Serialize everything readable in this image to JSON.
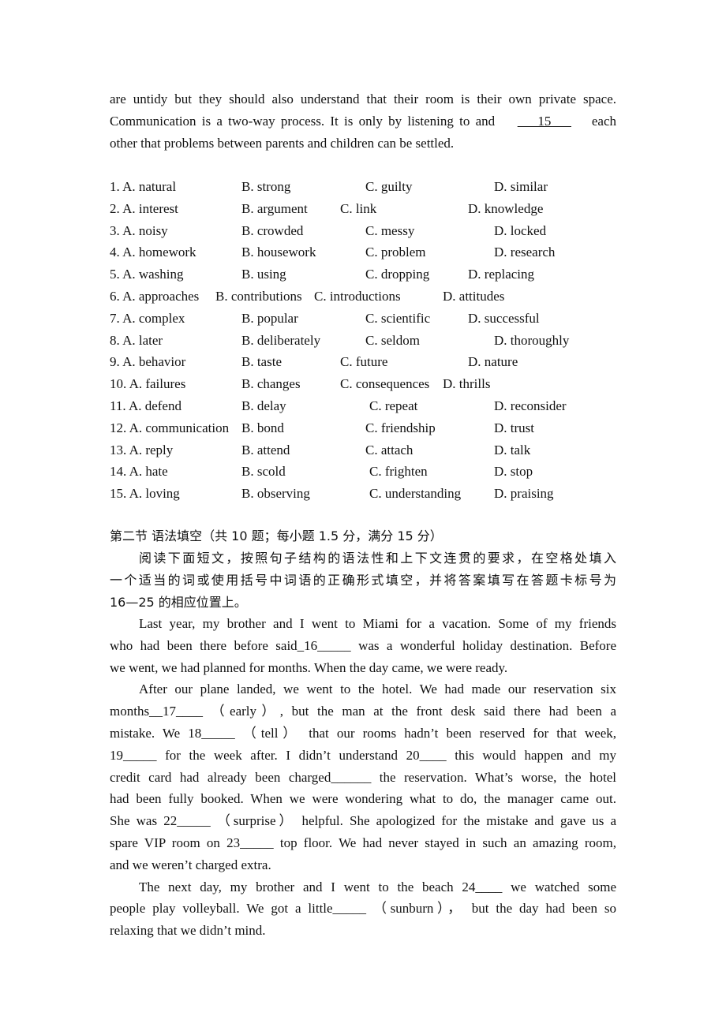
{
  "passage_end": {
    "lines": [
      "are untidy but they should also understand that their room is their own private space.",
      "Communication is a two-way process. It is only by listening to and",
      "other that problems between parents and children can be settled."
    ],
    "blank_15": "___15___",
    "after_blank_15": "each"
  },
  "options": [
    {
      "num": "1.",
      "a": "A. natural",
      "b": "B. strong",
      "c": "C. guilty",
      "d": "D. similar"
    },
    {
      "num": "2.",
      "a": "A. interest",
      "b": "B. argument",
      "c": "C. link",
      "d": "D. knowledge"
    },
    {
      "num": "3.",
      "a": "A. noisy",
      "b": "B. crowded",
      "c": "C. messy",
      "d": "D. locked"
    },
    {
      "num": "4.",
      "a": "A. homework",
      "b": "B. housework",
      "c": "C. problem",
      "d": "D. research"
    },
    {
      "num": "5.",
      "a": "A. washing",
      "b": "B. using",
      "c": "C. dropping",
      "d": "D. replacing"
    },
    {
      "num": "6.",
      "a": "A. approaches",
      "b": "B. contributions",
      "c": "C. introductions",
      "d": "D. attitudes"
    },
    {
      "num": "7.",
      "a": "A. complex",
      "b": "B. popular",
      "c": "C. scientific",
      "d": "D. successful"
    },
    {
      "num": "8.",
      "a": "A. later",
      "b": "B. deliberately",
      "c": "C. seldom",
      "d": "D. thoroughly"
    },
    {
      "num": "9.",
      "a": "A. behavior",
      "b": "B. taste",
      "c": "C. future",
      "d": "D. nature"
    },
    {
      "num": "10.",
      "a": "A. failures",
      "b": "B. changes",
      "c": "C. consequences",
      "d": "D. thrills"
    },
    {
      "num": "11.",
      "a": "A. defend",
      "b": "B. delay",
      "c": "C. repeat",
      "d": "D. reconsider"
    },
    {
      "num": "12.",
      "a": "A. communication",
      "b": "B. bond",
      "c": "C. friendship",
      "d": "D. trust"
    },
    {
      "num": "13.",
      "a": "A. reply",
      "b": "B. attend",
      "c": "C. attach",
      "d": "D. talk"
    },
    {
      "num": "14.",
      "a": "A. hate",
      "b": "B. scold",
      "c": "C. frighten",
      "d": "D. stop"
    },
    {
      "num": "15.",
      "a": "A. loving",
      "b": "B. observing",
      "c": "C. understanding",
      "d": "D. praising"
    }
  ],
  "section2": {
    "heading": "第二节  语法填空（共 10 题；每小题 1.5 分，满分 15 分）",
    "instructions": [
      "阅读下面短文，按照句子结构的语法性和上下文连贯的要求，在空格处填入",
      "一个适当的词或使用括号中词语的正确形式填空，并将答案填写在答题卡标号为",
      "16—25 的相应位置上。"
    ],
    "passage": [
      {
        "text": "Last year, my brother and I went to Miami for a vacation. Some of my friends",
        "indent": true
      },
      {
        "text": "who had been there before said_16_____ was a wonderful holiday destination. Before",
        "indent": false
      },
      {
        "text": "we went, we had planned for months. When the day came, we were ready.",
        "indent": false,
        "last": true
      },
      {
        "text": "After our plane landed, we went to the hotel. We had made our reservation six",
        "indent": true
      },
      {
        "text": "months__17____  （early）, but the man at the front desk said there had been a",
        "indent": false
      },
      {
        "text": "mistake. We 18_____ （tell） that our rooms hadn’t been reserved for that week,",
        "indent": false
      },
      {
        "text": "19_____ for the week after. I didn’t understand 20____ this would happen and my",
        "indent": false
      },
      {
        "text": "credit card had already been charged______ the reservation. What’s worse, the hotel",
        "indent": false
      },
      {
        "text": "had been fully booked. When we were wondering what to do, the manager came out.",
        "indent": false
      },
      {
        "text": "She was 22_____ （surprise） helpful. She apologized for the mistake and gave us a",
        "indent": false
      },
      {
        "text": "spare VIP room on 23_____ top floor. We had never stayed in such an amazing room,",
        "indent": false
      },
      {
        "text": "and we weren’t charged extra.",
        "indent": false,
        "last": true
      },
      {
        "text": "The next day, my brother and I went to the beach 24____ we watched some",
        "indent": true
      },
      {
        "text": "people play volleyball. We got a little_____ （sunburn）， but the day had been so",
        "indent": false
      },
      {
        "text": "relaxing that we didn’t mind.",
        "indent": false,
        "last": true
      }
    ]
  }
}
